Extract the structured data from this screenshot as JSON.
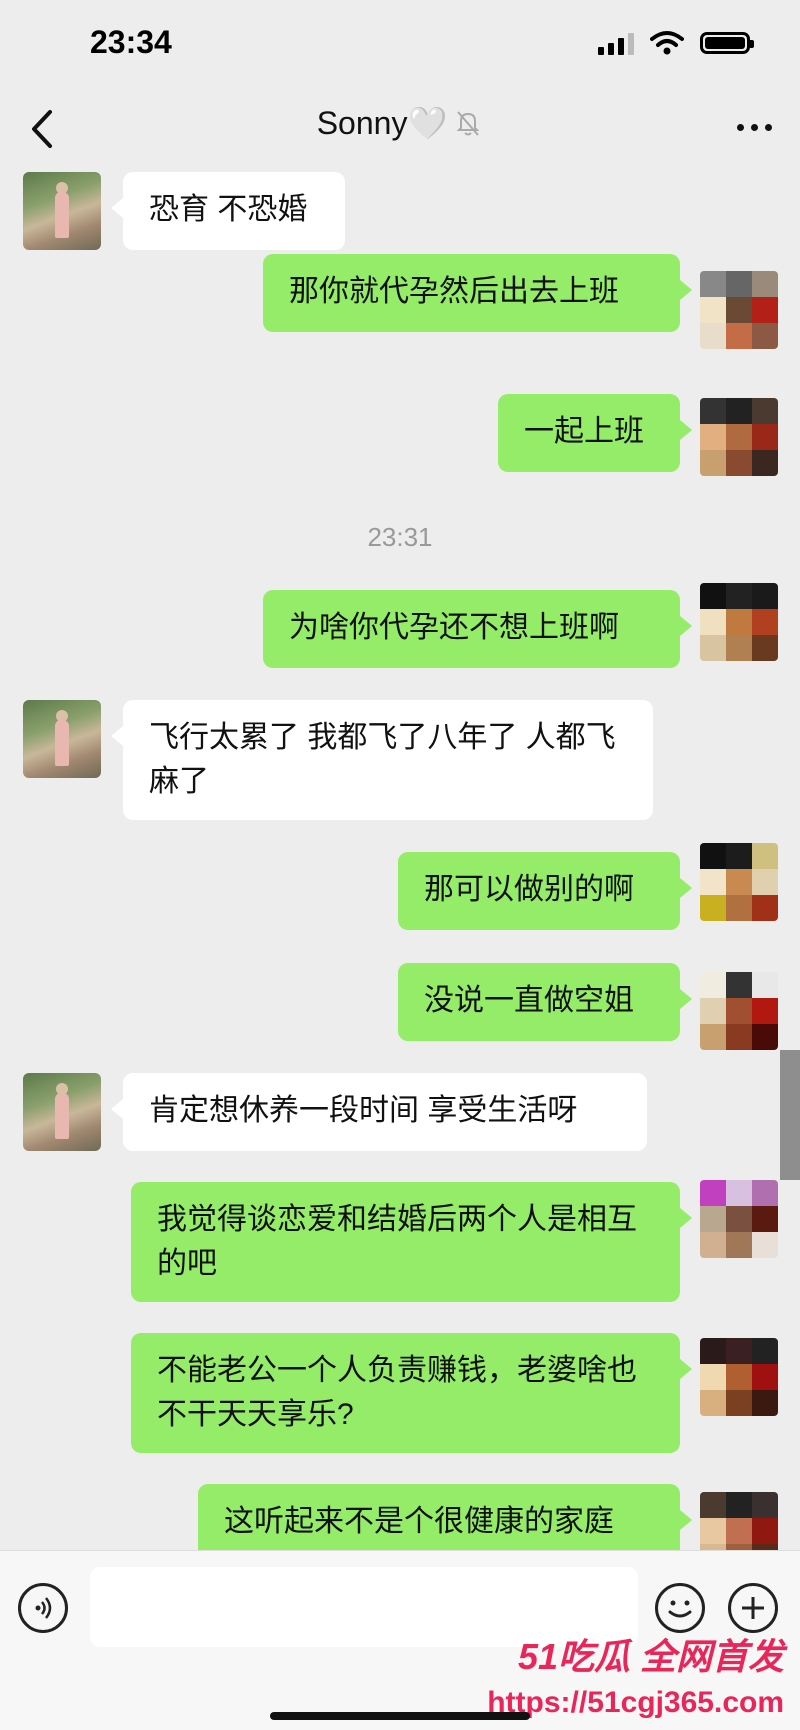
{
  "status_bar": {
    "time": "23:34"
  },
  "header": {
    "title": "Sonny🤍"
  },
  "messages": [
    {
      "side": "in",
      "text": "恐育 不恐婚"
    },
    {
      "side": "out",
      "text": "那你就代孕然后出去上班"
    },
    {
      "side": "out",
      "text": "一起上班"
    },
    {
      "side": "time",
      "text": "23:31"
    },
    {
      "side": "out",
      "text": "为啥你代孕还不想上班啊"
    },
    {
      "side": "in",
      "text": "飞行太累了 我都飞了八年了 人都飞麻了"
    },
    {
      "side": "out",
      "text": "那可以做别的啊"
    },
    {
      "side": "out",
      "text": "没说一直做空姐"
    },
    {
      "side": "in",
      "text": "肯定想休养一段时间 享受生活呀"
    },
    {
      "side": "out",
      "text": "我觉得谈恋爱和结婚后两个人是相互的吧"
    },
    {
      "side": "out",
      "text": "不能老公一个人负责赚钱，老婆啥也不干天天享乐?"
    },
    {
      "side": "out",
      "text": "这听起来不是个很健康的家庭"
    }
  ],
  "watermark": {
    "line1": "51吃瓜 全网首发",
    "line2": "https://51cgj365.com"
  },
  "colors": {
    "outgoing_bubble": "#95ec69",
    "incoming_bubble": "#ffffff",
    "background": "#ededed"
  }
}
